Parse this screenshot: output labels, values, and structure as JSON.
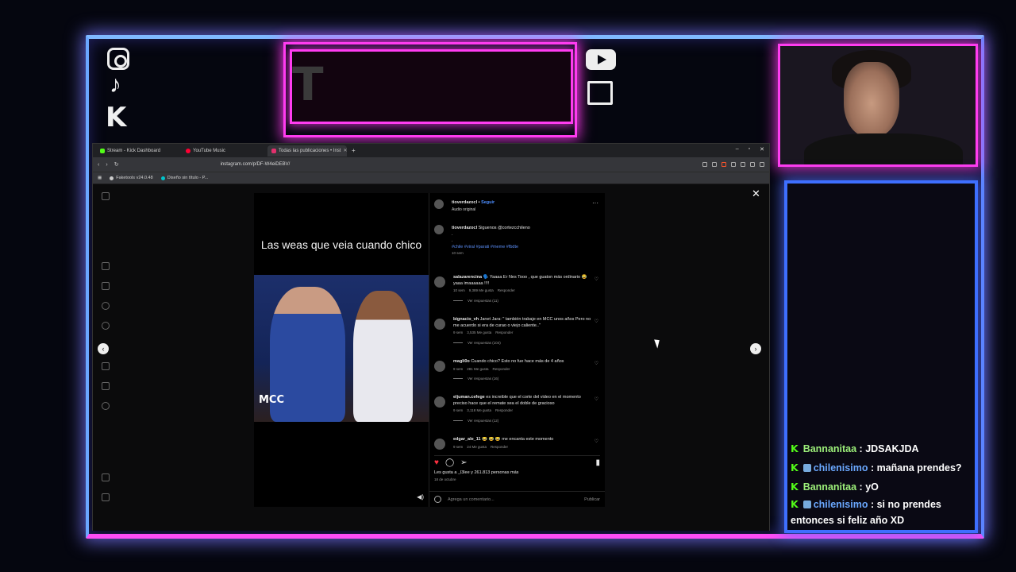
{
  "overlay": {
    "title_letter": "T",
    "chat_messages": [
      {
        "user": "Bannanitaa",
        "text": "JDSAKJDA",
        "badge": false
      },
      {
        "user": "chilenisimo",
        "text": "mañana prendes?",
        "badge": true
      },
      {
        "user": "Bannanitaa",
        "text": "yO",
        "badge": false
      },
      {
        "user": "chilenisimo",
        "text": "si no prendes entonces si feliz año XD",
        "badge": true
      }
    ],
    "chat_separator": " : ",
    "kick_glyph": "K"
  },
  "browser": {
    "tabs": [
      {
        "label": "Stream - Kick Dashboard",
        "color": "#53fc18",
        "active": false
      },
      {
        "label": "YouTube Music",
        "color": "#ff0033",
        "active": false
      },
      {
        "label": "Todas las publicaciones • Inst",
        "color": "#e1306c",
        "active": true
      }
    ],
    "new_tab": "+",
    "window_controls": [
      "–",
      "▫",
      "✕"
    ],
    "url": "instagram.com/p/DF-W4eiDEBV/",
    "bookmarks": [
      {
        "label": "Faketools v24.0.48",
        "color": "#cccccc"
      },
      {
        "label": "Diseño sin título - P...",
        "color": "#00c4cc"
      }
    ]
  },
  "post": {
    "video_caption": "Las weas que veia cuando chico",
    "video_watermark": "MCC",
    "author": "tioverdazocl",
    "follow_label": "Seguir",
    "audio": "Audio original",
    "caption_text": "Siguenos @cortezcchileno",
    "caption_dots": [
      ".",
      "."
    ],
    "hashtags": "#chile #viral #parati #meme #fbdte",
    "caption_time": "10 sem",
    "comments": [
      {
        "user": "salazarencina",
        "text": "🗣️ Yaaaa Er Nes Tooo , que guaton más ordinario 😂yaaa imaaaaaa !!!!",
        "time": "10 sem",
        "likes": "9,389 Me gusta",
        "reply": "Responder",
        "replies": "Ver respuestas (11)"
      },
      {
        "user": "bignacio_vh",
        "text": "Janet Jara: \" también trabaje en MCC unos años Pero no me acuerdo si era de curao o viejo caliente..\"",
        "time": "9 sem",
        "likes": "3,535 Me gusta",
        "reply": "Responder",
        "replies": "Ver respuestas (104)"
      },
      {
        "user": "magli0o",
        "text": "Cuando chico? Esto no fue hace más de 4 años",
        "time": "9 sem",
        "likes": "281 Me gusta",
        "reply": "Responder",
        "replies": "Ver respuestas (16)"
      },
      {
        "user": "eljuman.cefege",
        "text": "es increible que el corte del video en el momento preciso hace que el remate sea el doble de gracioso",
        "time": "9 sem",
        "likes": "3,118 Me gusta",
        "reply": "Responder",
        "replies": "Ver respuestas (12)"
      },
      {
        "user": "edgar_ale_11",
        "text": "😂 😂 😂 me encanta este momento",
        "time": "9 sem",
        "likes": "24 Me gusta",
        "reply": "Responder",
        "replies": ""
      }
    ],
    "likes_text": "Les gusta a _l3lee y 261.813 personas más",
    "date": "18 de octubre",
    "comment_placeholder": "Agrega un comentario...",
    "publish_label": "Publicar"
  }
}
